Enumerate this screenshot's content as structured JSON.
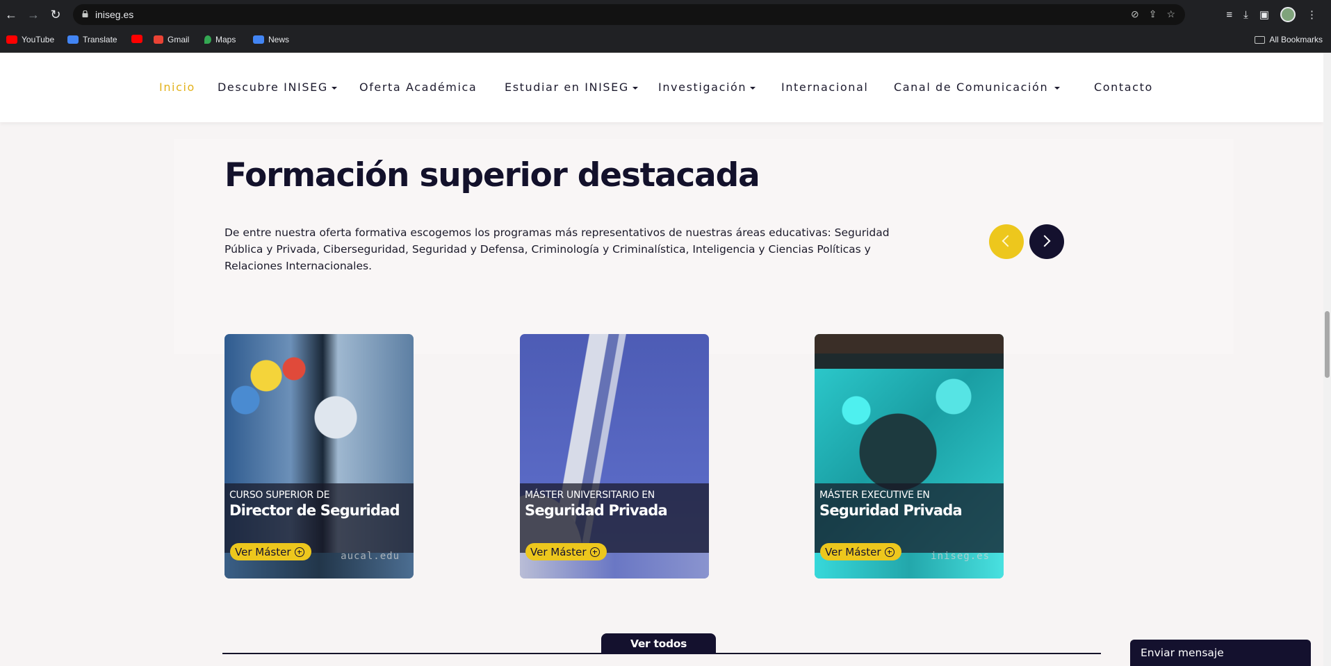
{
  "browser": {
    "url": "iniseg.es",
    "bookmarks": [
      {
        "label": "YouTube",
        "color": "#ff0000"
      },
      {
        "label": "Translate",
        "color": "#4285f4"
      },
      {
        "label": "",
        "color": "#ff0000"
      },
      {
        "label": "Gmail",
        "color": "#ea4335"
      },
      {
        "label": "Maps",
        "color": "#34a853"
      },
      {
        "label": "News",
        "color": "#4285f4"
      }
    ],
    "all_bookmarks": "All Bookmarks"
  },
  "nav": {
    "items": [
      {
        "label": "Inicio",
        "active": true,
        "dropdown": false
      },
      {
        "label": "Descubre INISEG",
        "active": false,
        "dropdown": true
      },
      {
        "label": "Oferta Académica",
        "active": false,
        "dropdown": false
      },
      {
        "label": "Estudiar en INISEG",
        "active": false,
        "dropdown": true
      },
      {
        "label": "Investigación",
        "active": false,
        "dropdown": true
      },
      {
        "label": "Internacional",
        "active": false,
        "dropdown": false
      },
      {
        "label": "Canal de Comunicación",
        "active": false,
        "dropdown": true
      },
      {
        "label": "Contacto",
        "active": false,
        "dropdown": false
      }
    ]
  },
  "section": {
    "title": "Formación superior destacada",
    "description": "De entre nuestra oferta formativa escogemos los programas más representativos de nuestras áreas educativas: Seguridad Pública y Privada, Ciberseguridad, Seguridad y Defensa, Criminología y Criminalística, Inteligencia y Ciencias Políticas y Relaciones Internacionales."
  },
  "cards": [
    {
      "label": "CURSO SUPERIOR DE",
      "title": "Director de Seguridad",
      "cta": "Ver Máster",
      "watermark": "aucal.edu"
    },
    {
      "label": "MÁSTER UNIVERSITARIO EN",
      "title": "Seguridad Privada",
      "cta": "Ver Máster",
      "watermark": ""
    },
    {
      "label": "MÁSTER EXECUTIVE EN",
      "title": "Seguridad Privada",
      "cta": "Ver Máster",
      "watermark": "iniseg.es"
    }
  ],
  "see_all": "Ver todos",
  "chat": {
    "label": "Enviar mensaje"
  },
  "colors": {
    "accent": "#edc71d",
    "navy": "#14112e",
    "active_nav": "#e3b21c"
  }
}
